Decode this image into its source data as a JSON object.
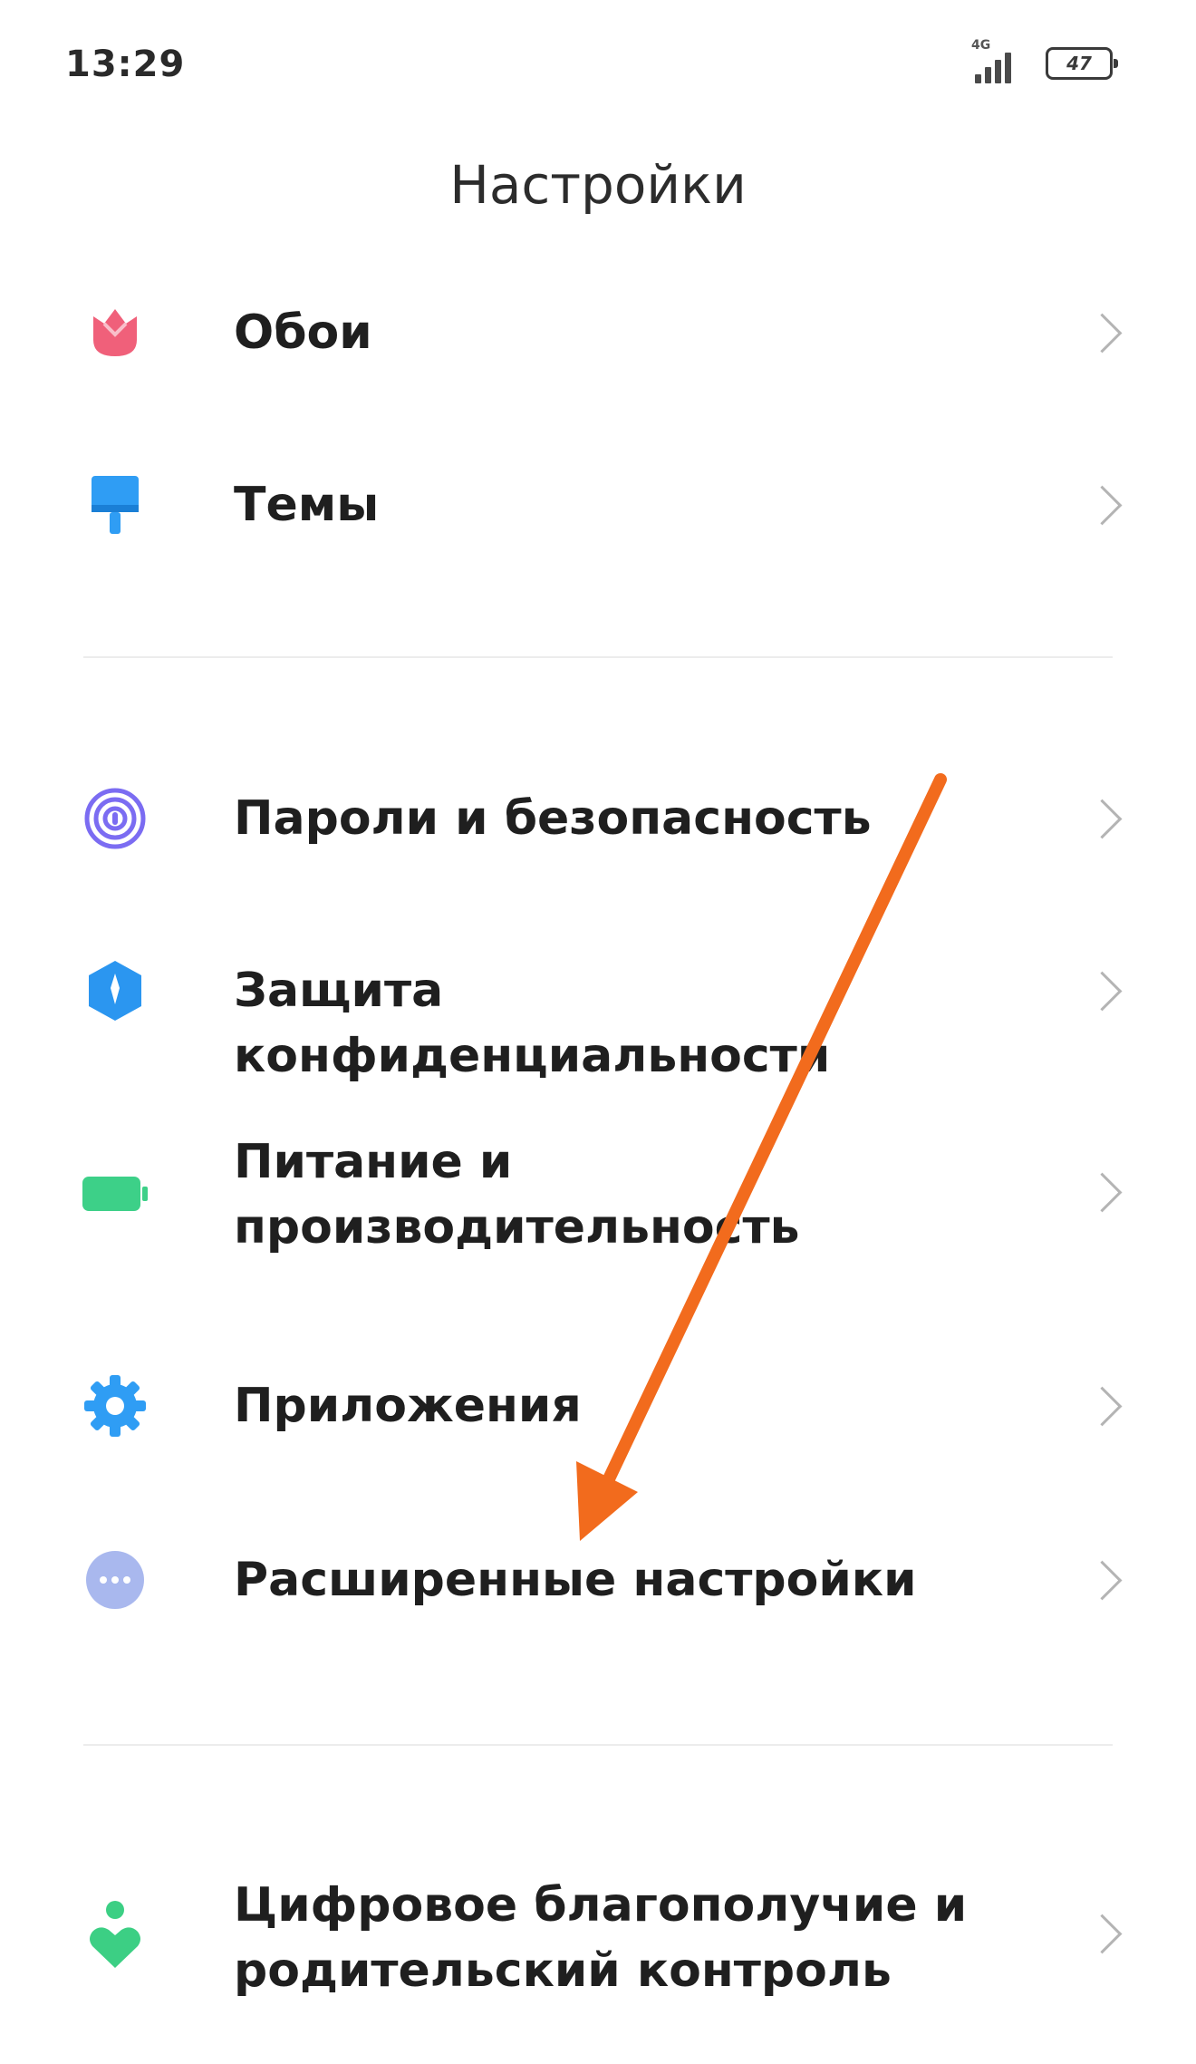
{
  "status_bar": {
    "time": "13:29",
    "network": "4G",
    "battery": "47"
  },
  "header": {
    "title": "Настройки"
  },
  "groups": [
    {
      "items": [
        {
          "label": "Обои",
          "icon": "wallpaper-icon"
        },
        {
          "label": "Темы",
          "icon": "themes-icon"
        }
      ]
    },
    {
      "items": [
        {
          "label": "Пароли и безопасность",
          "icon": "fingerprint-icon"
        },
        {
          "label": "Защита конфиденциальности",
          "icon": "privacy-shield-icon"
        },
        {
          "label": "Питание и производительность",
          "icon": "battery-icon"
        },
        {
          "label": "Приложения",
          "icon": "apps-gear-icon"
        },
        {
          "label": "Расширенные настройки",
          "icon": "more-dots-icon"
        }
      ]
    },
    {
      "items": [
        {
          "label": "Цифровое благополучие и родительский контроль",
          "icon": "wellbeing-icon"
        }
      ]
    }
  ],
  "colors": {
    "wallpaper": "#f0607a",
    "themes": "#2f9df4",
    "passwords": "#7b6cf2",
    "privacy": "#2b96f0",
    "power": "#3dd088",
    "apps": "#2f9df4",
    "advanced": "#a9b8ee",
    "wellbeing": "#3ccf84",
    "annotation_arrow": "#f26b1d"
  }
}
